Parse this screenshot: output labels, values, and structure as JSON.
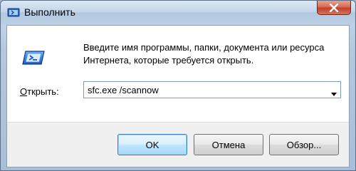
{
  "window": {
    "title": "Выполнить",
    "title_icon": "run-icon",
    "close_icon": "close-icon"
  },
  "dialog": {
    "icon": "run-program-icon",
    "description": "Введите имя программы, папки, документа или ресурса Интернета, которые требуется открыть.",
    "open_label_accel": "О",
    "open_label_rest": "ткрыть:",
    "open_value": "sfc.exe /scannow",
    "dropdown_icon": "chevron-down-icon"
  },
  "buttons": {
    "ok": "OK",
    "cancel": "Отмена",
    "browse": "Обзор..."
  },
  "colors": {
    "titlebar": "#c3d6e9",
    "close_button": "#c0412a",
    "focus_button_border": "#3c7fb1",
    "footer": "#f0f0f0"
  }
}
